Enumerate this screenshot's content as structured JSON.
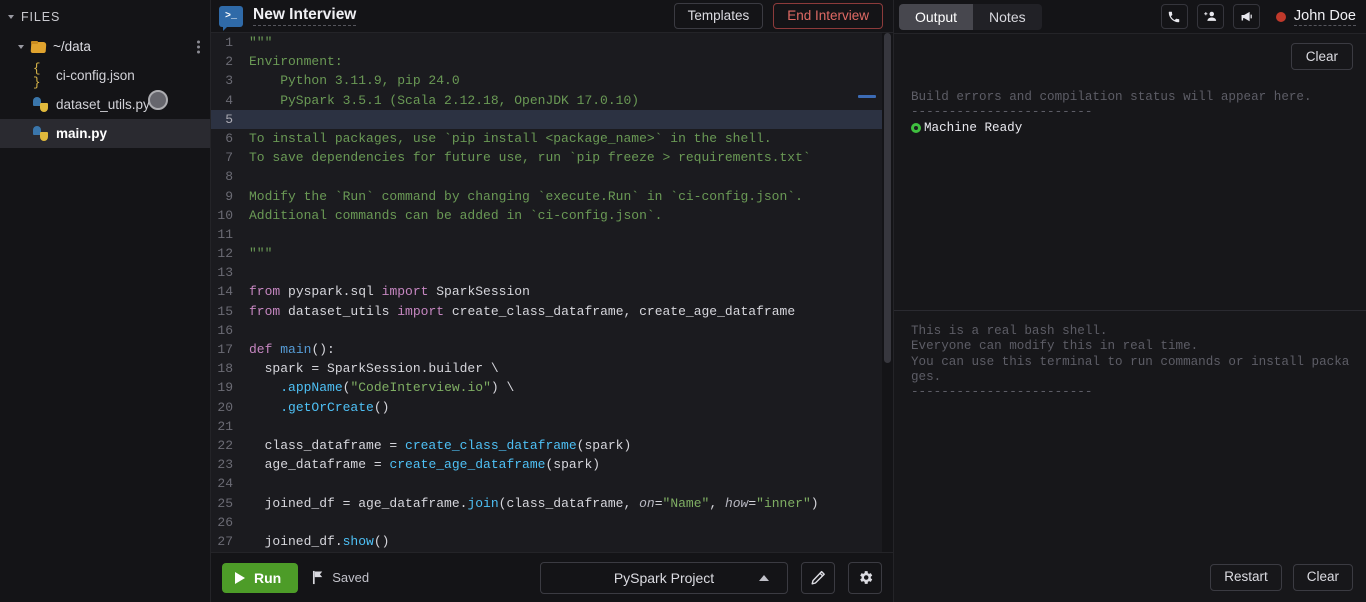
{
  "sidebar": {
    "header": "FILES",
    "folder": {
      "name": "~/data",
      "icon": "folder-icon",
      "menu_icon": "kebab-menu-icon"
    },
    "files": [
      {
        "name": "ci-config.json",
        "icon": "json-file-icon",
        "active": false
      },
      {
        "name": "dataset_utils.py",
        "icon": "python-file-icon",
        "active": false
      },
      {
        "name": "main.py",
        "icon": "python-file-icon",
        "active": true
      }
    ]
  },
  "topbar": {
    "logo_glyph": ">_",
    "title": "New Interview",
    "templates_label": "Templates",
    "end_interview_label": "End Interview"
  },
  "editor": {
    "lines": [
      {
        "n": "1",
        "tokens": [
          {
            "t": "\"\"\"",
            "c": "cmt"
          }
        ]
      },
      {
        "n": "2",
        "tokens": [
          {
            "t": "Environment:",
            "c": "cmt"
          }
        ]
      },
      {
        "n": "3",
        "tokens": [
          {
            "t": "    Python 3.11.9, pip 24.0",
            "c": "cmt"
          }
        ]
      },
      {
        "n": "4",
        "tokens": [
          {
            "t": "    PySpark 3.5.1 (Scala 2.12.18, OpenJDK 17.0.10)",
            "c": "cmt"
          }
        ]
      },
      {
        "n": "5",
        "tokens": [],
        "highlight": true
      },
      {
        "n": "6",
        "tokens": [
          {
            "t": "To install packages, use `pip install <package_name>` in the shell.",
            "c": "cmt"
          }
        ]
      },
      {
        "n": "7",
        "tokens": [
          {
            "t": "To save dependencies for future use, run `pip freeze > requirements.txt`",
            "c": "cmt"
          }
        ]
      },
      {
        "n": "8",
        "tokens": []
      },
      {
        "n": "9",
        "tokens": [
          {
            "t": "Modify the `Run` command by changing `execute.Run` in `ci-config.json`.",
            "c": "cmt"
          }
        ]
      },
      {
        "n": "10",
        "tokens": [
          {
            "t": "Additional commands can be added in `ci-config.json`.",
            "c": "cmt"
          }
        ]
      },
      {
        "n": "11",
        "tokens": []
      },
      {
        "n": "12",
        "tokens": [
          {
            "t": "\"\"\"",
            "c": "cmt"
          }
        ]
      },
      {
        "n": "13",
        "tokens": []
      },
      {
        "n": "14",
        "tokens": [
          {
            "t": "from",
            "c": "kw"
          },
          {
            "t": " pyspark.sql ",
            "c": ""
          },
          {
            "t": "import",
            "c": "kw"
          },
          {
            "t": " SparkSession",
            "c": ""
          }
        ]
      },
      {
        "n": "15",
        "tokens": [
          {
            "t": "from",
            "c": "kw"
          },
          {
            "t": " dataset_utils ",
            "c": ""
          },
          {
            "t": "import",
            "c": "kw"
          },
          {
            "t": " create_class_dataframe, create_age_dataframe",
            "c": ""
          }
        ]
      },
      {
        "n": "16",
        "tokens": []
      },
      {
        "n": "17",
        "tokens": [
          {
            "t": "def",
            "c": "kw"
          },
          {
            "t": " ",
            "c": ""
          },
          {
            "t": "main",
            "c": "kw2"
          },
          {
            "t": "():",
            "c": ""
          }
        ]
      },
      {
        "n": "18",
        "tokens": [
          {
            "t": "  spark = SparkSession.builder \\",
            "c": ""
          }
        ]
      },
      {
        "n": "19",
        "tokens": [
          {
            "t": "    ",
            "c": ""
          },
          {
            "t": ".appName",
            "c": "fn"
          },
          {
            "t": "(",
            "c": ""
          },
          {
            "t": "\"CodeInterview.io\"",
            "c": "str"
          },
          {
            "t": ") \\",
            "c": ""
          }
        ]
      },
      {
        "n": "20",
        "tokens": [
          {
            "t": "    ",
            "c": ""
          },
          {
            "t": ".getOrCreate",
            "c": "fn"
          },
          {
            "t": "()",
            "c": ""
          }
        ]
      },
      {
        "n": "21",
        "tokens": []
      },
      {
        "n": "22",
        "tokens": [
          {
            "t": "  class_dataframe = ",
            "c": ""
          },
          {
            "t": "create_class_dataframe",
            "c": "fn"
          },
          {
            "t": "(spark)",
            "c": ""
          }
        ]
      },
      {
        "n": "23",
        "tokens": [
          {
            "t": "  age_dataframe = ",
            "c": ""
          },
          {
            "t": "create_age_dataframe",
            "c": "fn"
          },
          {
            "t": "(spark)",
            "c": ""
          }
        ]
      },
      {
        "n": "24",
        "tokens": []
      },
      {
        "n": "25",
        "tokens": [
          {
            "t": "  joined_df = age_dataframe.",
            "c": ""
          },
          {
            "t": "join",
            "c": "fn"
          },
          {
            "t": "(class_dataframe, ",
            "c": ""
          },
          {
            "t": "on",
            "c": "param"
          },
          {
            "t": "=",
            "c": ""
          },
          {
            "t": "\"Name\"",
            "c": "str"
          },
          {
            "t": ", ",
            "c": ""
          },
          {
            "t": "how",
            "c": "param"
          },
          {
            "t": "=",
            "c": ""
          },
          {
            "t": "\"inner\"",
            "c": "str"
          },
          {
            "t": ")",
            "c": ""
          }
        ]
      },
      {
        "n": "26",
        "tokens": []
      },
      {
        "n": "27",
        "tokens": [
          {
            "t": "  joined_df.",
            "c": ""
          },
          {
            "t": "show",
            "c": "fn"
          },
          {
            "t": "()",
            "c": ""
          }
        ]
      }
    ]
  },
  "bottombar": {
    "run_label": "Run",
    "saved_label": "Saved",
    "project_name": "PySpark Project",
    "edit_icon": "pencil-icon",
    "settings_icon": "gear-icon"
  },
  "right": {
    "tabs": [
      {
        "label": "Output",
        "active": true
      },
      {
        "label": "Notes",
        "active": false
      }
    ],
    "actions": [
      {
        "icon": "phone-icon",
        "glyph": "✆"
      },
      {
        "icon": "add-person-icon",
        "glyph": "὆4"
      },
      {
        "icon": "megaphone-icon",
        "glyph": "὎3"
      }
    ],
    "user_name": "John Doe",
    "output": {
      "clear_label": "Clear",
      "placeholder_line": "Build errors and compilation status will appear here.",
      "divider": "------------------------",
      "status": "Machine Ready"
    },
    "terminal": {
      "lines": [
        "This is a real bash shell.",
        "Everyone can modify this in real time.",
        "You can use this terminal to run commands or install packages.",
        "------------------------"
      ],
      "restart_label": "Restart",
      "clear_label": "Clear"
    }
  },
  "colors": {
    "accent_green": "#4d9c28",
    "danger_red": "#e06a64",
    "record_red": "#c0392b",
    "ready_green": "#3fbf3f",
    "logo_blue": "#2f6aa8"
  }
}
